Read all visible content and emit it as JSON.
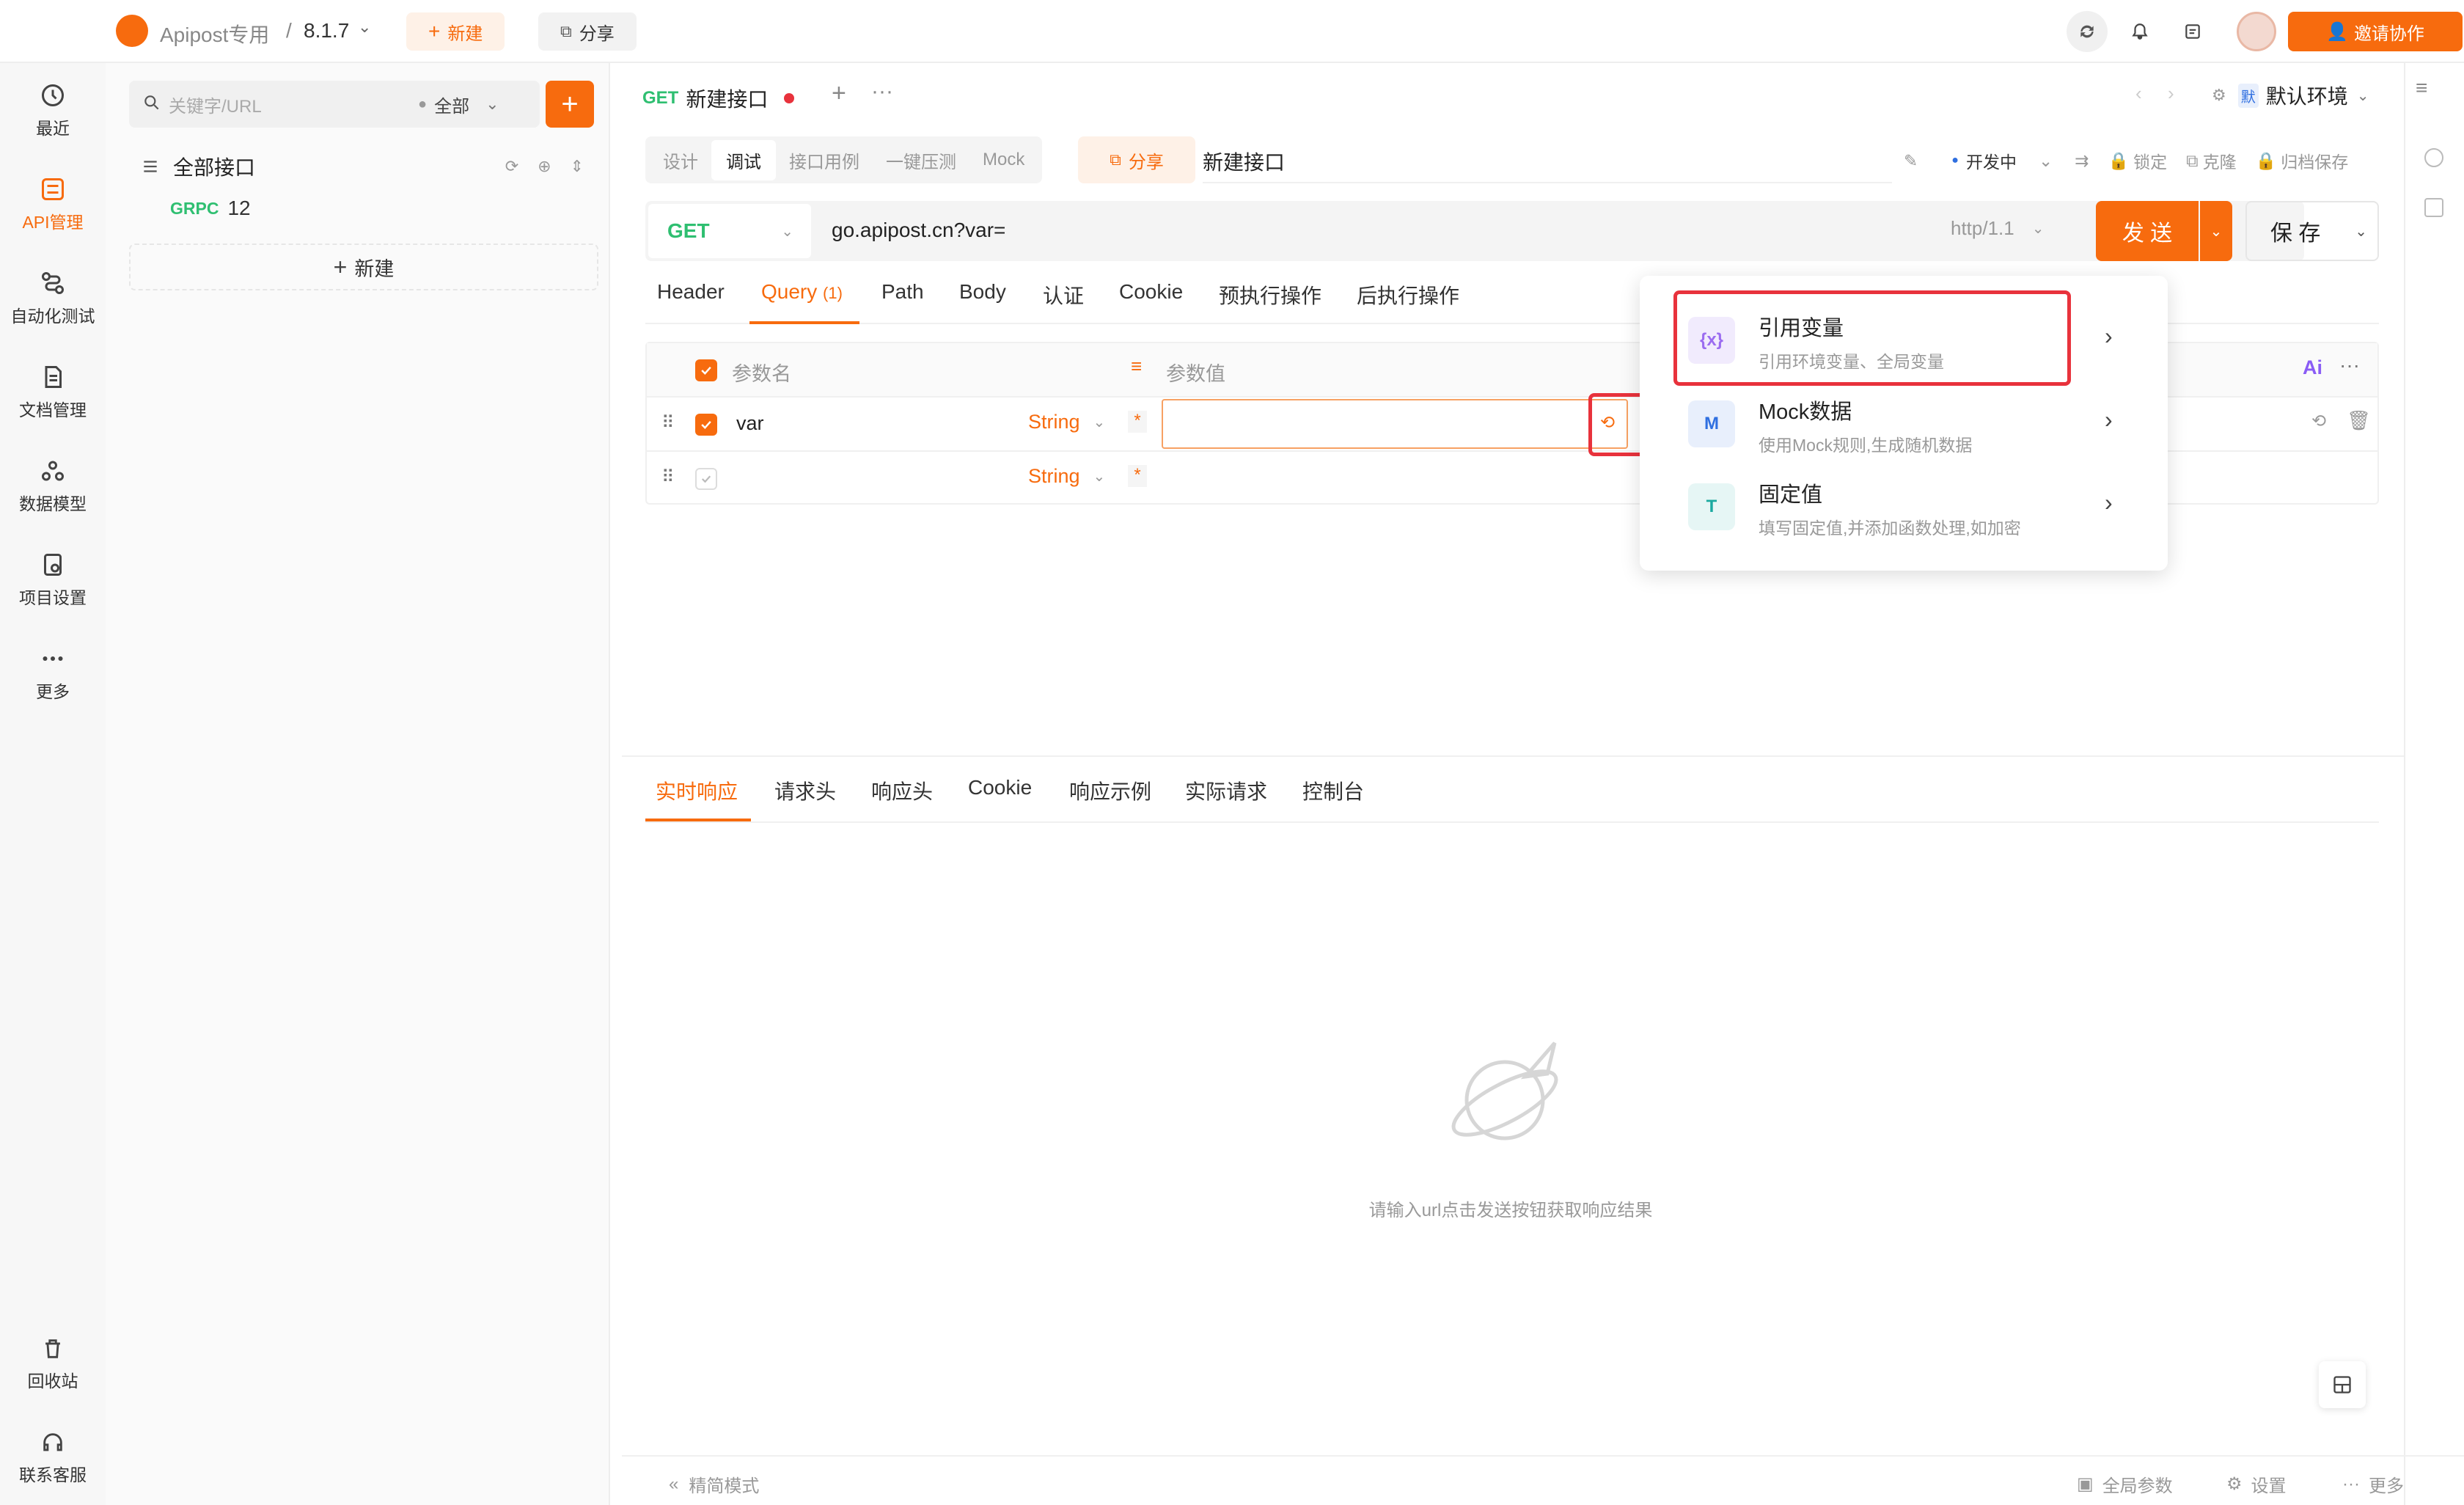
{
  "topbar": {
    "project_name": "Apipost专用",
    "separator": "/",
    "version": "8.1.7",
    "new_label": "新建",
    "share_label": "分享",
    "invite_label": "邀请协作"
  },
  "leftnav": {
    "items": [
      {
        "label": "最近",
        "icon": "history-icon"
      },
      {
        "label": "API管理",
        "icon": "api-icon"
      },
      {
        "label": "自动化测试",
        "icon": "automation-icon"
      },
      {
        "label": "文档管理",
        "icon": "document-icon"
      },
      {
        "label": "数据模型",
        "icon": "data-model-icon"
      },
      {
        "label": "项目设置",
        "icon": "settings-icon"
      },
      {
        "label": "更多",
        "icon": "more-icon"
      }
    ],
    "bottom": [
      {
        "label": "回收站",
        "icon": "trash-icon"
      },
      {
        "label": "联系客服",
        "icon": "headset-icon"
      }
    ]
  },
  "tree": {
    "search_placeholder": "关键字/URL",
    "filter_label": "全部",
    "all_apis": "全部接口",
    "grpc_tag": "GRPC",
    "grpc_count": "12",
    "new_label": "新建"
  },
  "tabs": {
    "active_method": "GET",
    "active_title": "新建接口",
    "env_badge": "默",
    "env_label": "默认环境"
  },
  "subtabs": {
    "items": [
      "设计",
      "调试",
      "接口用例",
      "一键压测",
      "Mock"
    ],
    "share_label": "分享",
    "api_name": "新建接口",
    "status": "开发中",
    "lock": "锁定",
    "clone": "克隆",
    "archive": "归档保存"
  },
  "request": {
    "method": "GET",
    "url": "go.apipost.cn?var=",
    "protocol": "http/1.1",
    "send_label": "发 送",
    "save_label": "保 存"
  },
  "param_tabs": {
    "header": "Header",
    "query": "Query",
    "query_count": "(1)",
    "path": "Path",
    "body": "Body",
    "auth": "认证",
    "cookie": "Cookie",
    "pre": "预执行操作",
    "post": "后执行操作"
  },
  "table": {
    "col_name": "参数名",
    "col_value": "参数值",
    "ai_label": "Ai",
    "rows": [
      {
        "name": "var",
        "type": "String",
        "required": "*",
        "checked": true
      },
      {
        "name": "",
        "type": "String",
        "required": "*",
        "checked": false
      }
    ]
  },
  "dropdown": {
    "items": [
      {
        "icon_text": "{x}",
        "title": "引用变量",
        "desc": "引用环境变量、全局变量",
        "color": "#9b6cf0",
        "bg": "#f1ebfd"
      },
      {
        "icon_text": "M",
        "title": "Mock数据",
        "desc": "使用Mock规则,生成随机数据",
        "color": "#2f6fe0",
        "bg": "#e8effc"
      },
      {
        "icon_text": "T",
        "title": "固定值",
        "desc": "填写固定值,并添加函数处理,如加密",
        "color": "#1aa9a0",
        "bg": "#e6f6f5"
      }
    ]
  },
  "response": {
    "tabs": [
      "实时响应",
      "请求头",
      "响应头",
      "Cookie",
      "响应示例",
      "实际请求",
      "控制台"
    ],
    "empty_text": "请输入url点击发送按钮获取响应结果"
  },
  "footer": {
    "compact_mode": "精简模式",
    "global_params": "全局参数",
    "settings": "设置",
    "more": "更多"
  },
  "colors": {
    "accent": "#f76b0e",
    "get": "#2fbf71",
    "highlight": "#e8323c"
  }
}
